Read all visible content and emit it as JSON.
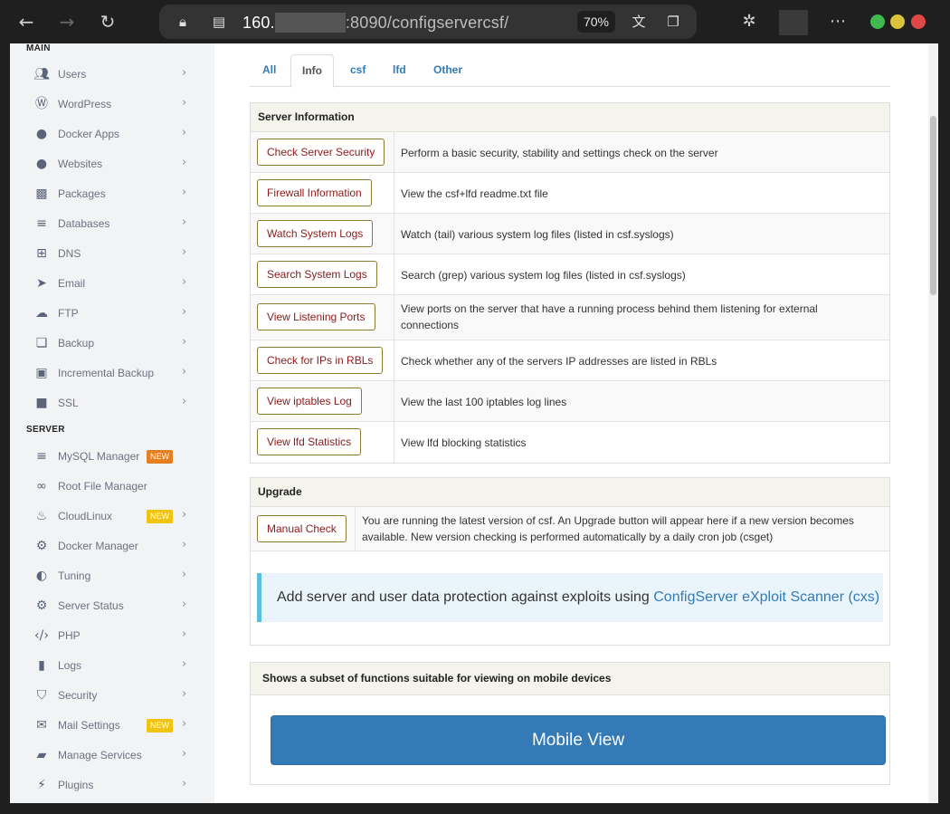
{
  "browser": {
    "url_host": "160.",
    "url_rest": ":8090/configservercsf/",
    "zoom": "70%"
  },
  "sidebar": {
    "section_main": "MAIN",
    "section_server": "SERVER",
    "main_items": [
      {
        "label": "Users",
        "icon": "users-icon"
      },
      {
        "label": "WordPress",
        "icon": "wordpress-icon"
      },
      {
        "label": "Docker Apps",
        "icon": "globe-icon"
      },
      {
        "label": "Websites",
        "icon": "globe-icon"
      },
      {
        "label": "Packages",
        "icon": "packages-icon"
      },
      {
        "label": "Databases",
        "icon": "database-icon"
      },
      {
        "label": "DNS",
        "icon": "sitemap-icon"
      },
      {
        "label": "Email",
        "icon": "paper-plane-icon"
      },
      {
        "label": "FTP",
        "icon": "cloud-upload-icon"
      },
      {
        "label": "Backup",
        "icon": "backup-icon"
      },
      {
        "label": "Incremental Backup",
        "icon": "save-icon"
      },
      {
        "label": "SSL",
        "icon": "lock-icon"
      }
    ],
    "server_items": [
      {
        "label": "MySQL Manager",
        "icon": "database-icon",
        "badge": "NEW"
      },
      {
        "label": "Root File Manager",
        "icon": "link-icon"
      },
      {
        "label": "CloudLinux",
        "icon": "cloudlinux-icon",
        "badge": "NEW"
      },
      {
        "label": "Docker Manager",
        "icon": "cogs-icon"
      },
      {
        "label": "Tuning",
        "icon": "adjust-icon"
      },
      {
        "label": "Server Status",
        "icon": "gear-icon"
      },
      {
        "label": "PHP",
        "icon": "code-icon"
      },
      {
        "label": "Logs",
        "icon": "file-icon"
      },
      {
        "label": "Security",
        "icon": "shield-icon"
      },
      {
        "label": "Mail Settings",
        "icon": "envelope-icon",
        "badge": "NEW"
      },
      {
        "label": "Manage Services",
        "icon": "folder-open-icon"
      },
      {
        "label": "Plugins",
        "icon": "plug-icon"
      }
    ]
  },
  "tabs": [
    "All",
    "Info",
    "csf",
    "lfd",
    "Other"
  ],
  "active_tab": "Info",
  "server_info": {
    "title": "Server Information",
    "rows": [
      {
        "button": "Check Server Security",
        "desc": "Perform a basic security, stability and settings check on the server"
      },
      {
        "button": "Firewall Information",
        "desc": "View the csf+lfd readme.txt file"
      },
      {
        "button": "Watch System Logs",
        "desc": "Watch (tail) various system log files (listed in csf.syslogs)"
      },
      {
        "button": "Search System Logs",
        "desc": "Search (grep) various system log files (listed in csf.syslogs)"
      },
      {
        "button": "View Listening Ports",
        "desc": "View ports on the server that have a running process behind them listening for external connections"
      },
      {
        "button": "Check for IPs in RBLs",
        "desc": "Check whether any of the servers IP addresses are listed in RBLs"
      },
      {
        "button": "View iptables Log",
        "desc": "View the last 100 iptables log lines"
      },
      {
        "button": "View lfd Statistics",
        "desc": "View lfd blocking statistics"
      }
    ]
  },
  "upgrade": {
    "title": "Upgrade",
    "button": "Manual Check",
    "desc": "You are running the latest version of csf. An Upgrade button will appear here if a new version becomes available. New version checking is performed automatically by a daily cron job (csget)",
    "callout_text": "Add server and user data protection against exploits using ",
    "callout_link": "ConfigServer eXploit Scanner (cxs)"
  },
  "mobile": {
    "title": "Shows a subset of functions suitable for viewing on mobile devices",
    "button": "Mobile View"
  },
  "colors": {
    "link": "#337ab7",
    "button_text": "#8b1a1a",
    "panel_head": "#f4f3ec",
    "badge_orange": "#e67e22",
    "badge_yellow": "#f1c40f"
  }
}
